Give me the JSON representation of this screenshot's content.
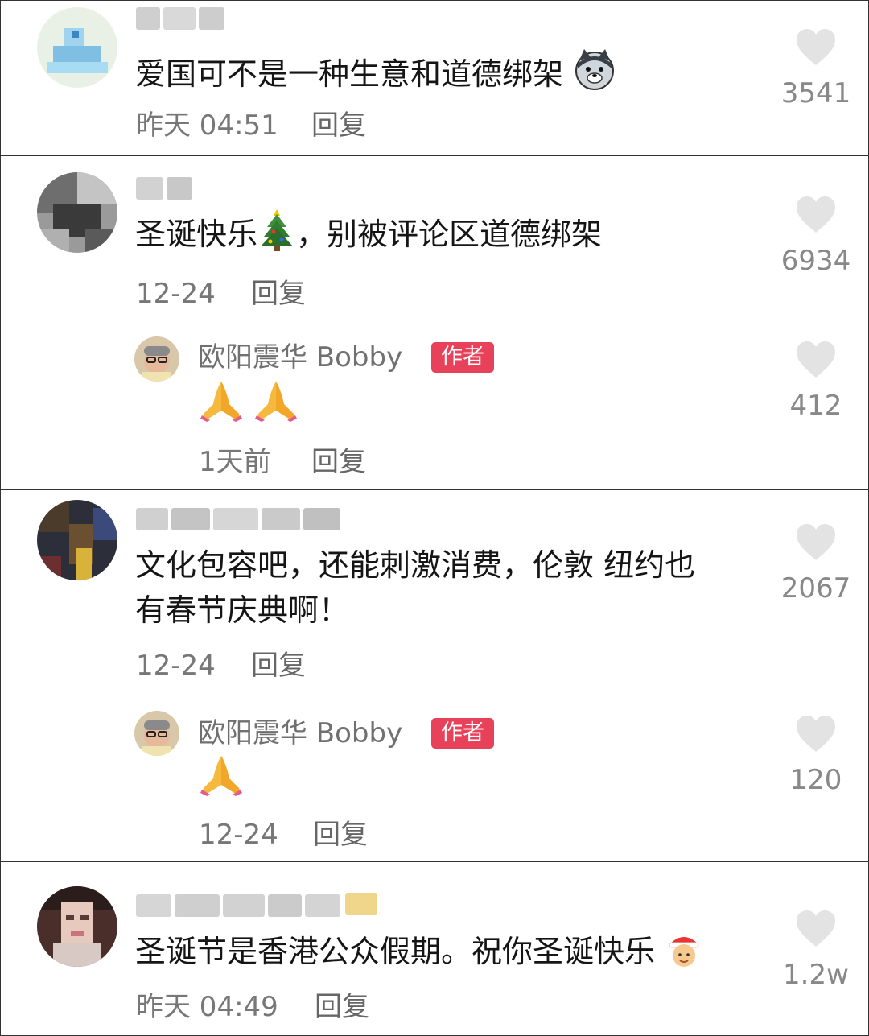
{
  "comments": [
    {
      "text": "爱国可不是一种生意和道德绑架",
      "time": "昨天 04:51",
      "reply_label": "回复",
      "likes": "3541",
      "emoji": "dog-face-icon"
    },
    {
      "text": "圣诞快乐",
      "text_after_emoji": "，别被评论区道德绑架",
      "time": "12-24",
      "reply_label": "回复",
      "likes": "6934",
      "emoji": "christmas-tree-icon",
      "replies": [
        {
          "author": "欧阳震华 Bobby",
          "tag": "作者",
          "content_emoji": "folded-hands-icon x2",
          "time": "1天前",
          "reply_label": "回复",
          "likes": "412"
        }
      ]
    },
    {
      "text_line1": "文化包容吧，还能刺激消费，伦敦 纽约也",
      "text_line2": "有春节庆典啊！",
      "time": "12-24",
      "reply_label": "回复",
      "likes": "2067",
      "replies": [
        {
          "author": "欧阳震华 Bobby",
          "tag": "作者",
          "content_emoji": "folded-hands-icon",
          "time": "12-24",
          "reply_label": "回复",
          "likes": "120"
        }
      ]
    },
    {
      "text": "圣诞节是香港公众假期。祝你圣诞快乐",
      "time": "昨天 04:49",
      "reply_label": "回复",
      "likes": "1.2w",
      "emoji": "santa-baby-icon"
    }
  ],
  "colors": {
    "author_tag": "#e8425a",
    "heart": "#e3e3e3",
    "meta_text": "#777777"
  }
}
